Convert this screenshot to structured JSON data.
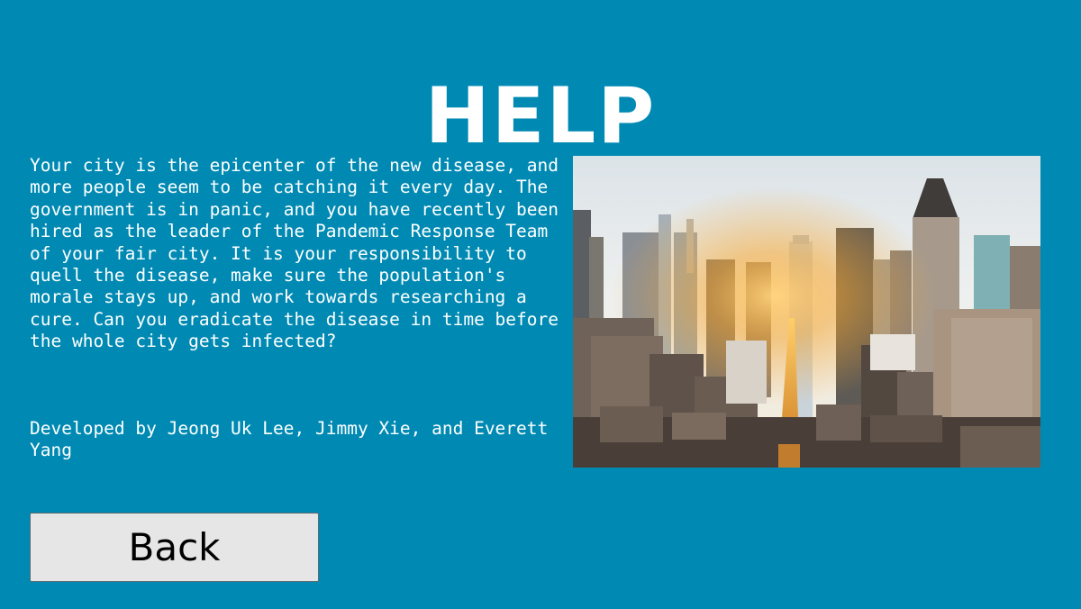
{
  "screen": {
    "title": "HELP",
    "background_color": "#008ab3"
  },
  "help": {
    "description": "Your city is the epicenter of the new disease, and more people seem to be catching it every day. The government is in panic, and you have recently been hired as the leader of the Pandemic Response Team of your fair city. It is your responsibility to quell the disease, make sure the population's morale stays up, and work towards researching a cure. Can you eradicate the disease in time before the whole city gets infected?",
    "credits": "Developed by Jeong Uk Lee, Jimmy Xie, and Everett Yang"
  },
  "image": {
    "subject": "city skyline photo at sunset"
  },
  "buttons": {
    "back_label": "Back"
  }
}
